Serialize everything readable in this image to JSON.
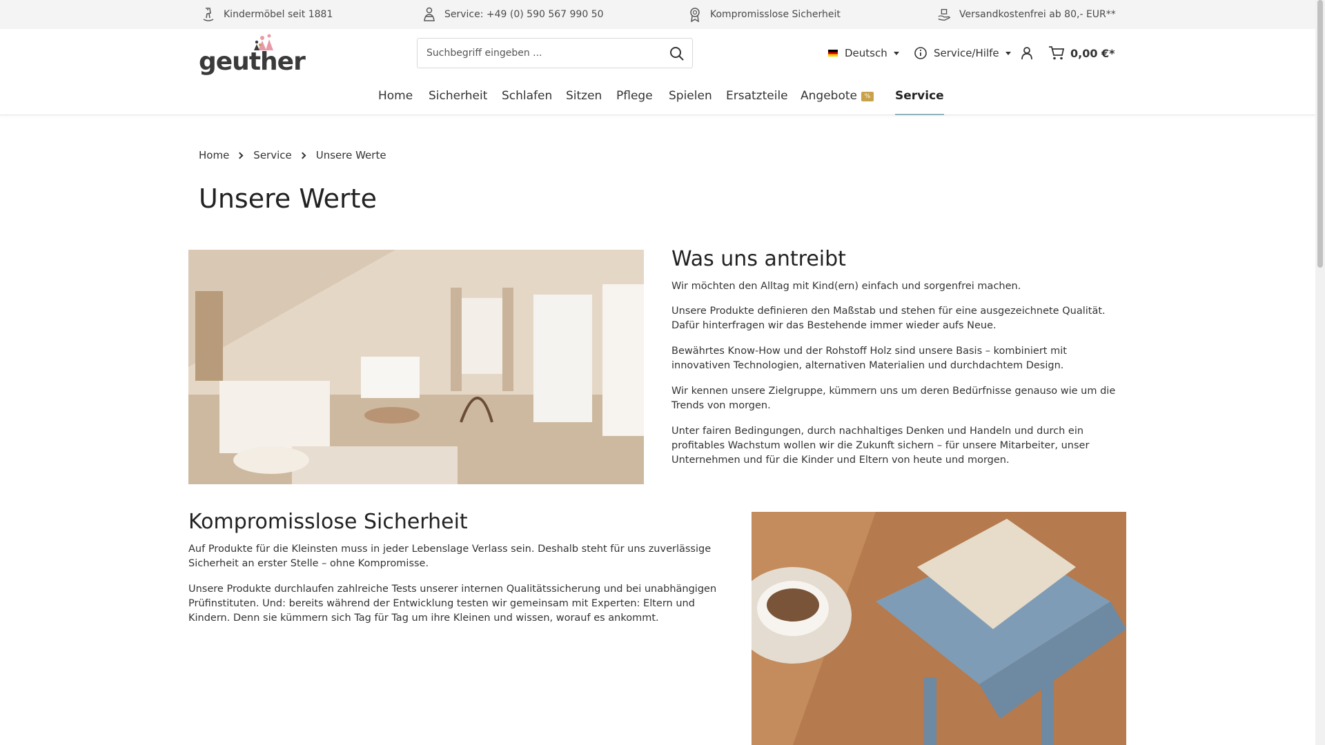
{
  "usp": [
    {
      "icon": "rocking-horse-icon",
      "text": "Kindermöbel seit 1881"
    },
    {
      "icon": "service-person-icon",
      "text": "Service: +49 (0) 590 567 990 50"
    },
    {
      "icon": "seal-icon",
      "text": "Kompromisslose Sicherheit"
    },
    {
      "icon": "hand-package-icon",
      "text": "Versandkostenfrei ab 80,- EUR**"
    }
  ],
  "logo": {
    "text": "geuther"
  },
  "search": {
    "placeholder": "Suchbegriff eingeben ..."
  },
  "header": {
    "language": "Deutsch",
    "service": "Service/Hilfe",
    "cart_total": "0,00 €*"
  },
  "nav": [
    {
      "label": "Home"
    },
    {
      "label": "Sicherheit"
    },
    {
      "label": "Schlafen"
    },
    {
      "label": "Sitzen"
    },
    {
      "label": "Pflege"
    },
    {
      "label": "Spielen"
    },
    {
      "label": "Ersatzteile"
    },
    {
      "label": "Angebote",
      "badge": "%"
    },
    {
      "label": "Service",
      "active": true
    }
  ],
  "breadcrumb": [
    "Home",
    "Service",
    "Unsere Werte"
  ],
  "page_title": "Unsere Werte",
  "section1": {
    "heading": "Was uns antreibt",
    "paragraphs": [
      "Wir möchten den Alltag mit Kind(ern) einfach und sorgenfrei machen.",
      "Unsere Produkte definieren den Maßstab und stehen für eine ausgezeichnete Qualität. Dafür hinterfragen wir das Bestehende immer wieder aufs Neue.",
      "Bewährtes Know-How und der Rohstoff Holz sind unsere Basis – kombiniert mit innovativen Technologien, alternativen Materialien und durchdachtem Design.",
      "Wir kennen unsere Zielgruppe, kümmern uns um deren Bedürfnisse genauso wie um die Trends von morgen.",
      "Unter fairen Bedingungen, durch nachhaltiges Denken und Handeln und durch ein profitables Wachstum wollen wir die Zukunft sichern – für unsere Mitarbeiter, unser Unternehmen und für die Kinder und Eltern von heute und morgen."
    ]
  },
  "section2": {
    "heading": "Kompromisslose Sicherheit",
    "paragraphs": [
      "Auf Produkte für die Kleinsten muss in jeder Lebenslage Verlass sein. Deshalb steht für uns zuverlässige Sicherheit an erster Stelle – ohne Kompromisse.",
      "Unsere Produkte durchlaufen zahlreiche Tests unserer internen Qualitätssicherung und bei unabhängigen Prüfinstituten. Und: bereits während der Entwicklung testen wir gemeinsam mit Experten: Eltern und Kindern. Denn sie kümmern sich Tag für Tag um ihre Kleinen und wissen, worauf es ankommt."
    ]
  },
  "colors": {
    "accent": "#8fb3b8",
    "badge": "#c9a14a",
    "logo_pink": "#e89aa8"
  }
}
